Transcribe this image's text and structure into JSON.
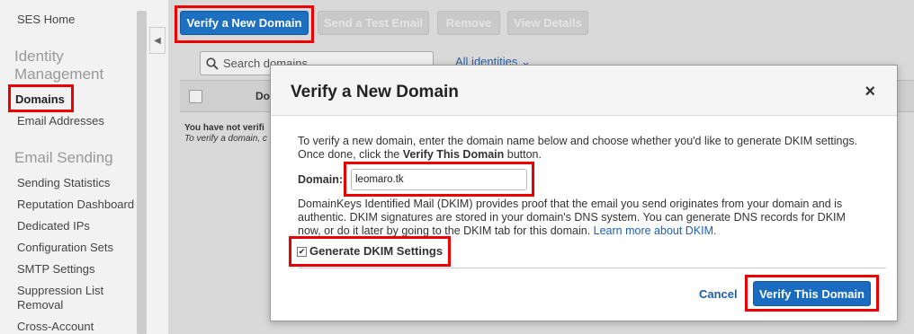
{
  "sidebar": {
    "ses_home": "SES Home",
    "identity_heading_1": "Identity",
    "identity_heading_2": "Management",
    "domains": "Domains",
    "email_addresses": "Email Addresses",
    "email_sending_heading": "Email Sending",
    "items": [
      "Sending Statistics",
      "Reputation Dashboard",
      "Dedicated IPs",
      "Configuration Sets",
      "SMTP Settings",
      "Suppression List",
      "Removal",
      "Cross-Account"
    ]
  },
  "toolbar": {
    "verify_domain": "Verify a New Domain",
    "send_test": "Send a Test Email",
    "remove": "Remove",
    "view_details": "View Details"
  },
  "search": {
    "placeholder": "Search domains"
  },
  "filter": {
    "label": "All identities"
  },
  "table": {
    "column": "Do",
    "empty_line_1": "You have not verifi",
    "empty_line_2": "To verify a domain, c"
  },
  "modal": {
    "title": "Verify a New Domain",
    "close": "×",
    "intro_1": "To verify a new domain, enter the domain name below and choose whether you'd like to generate DKIM settings.",
    "intro_2a": "Once done, click the ",
    "intro_2b": "Verify This Domain",
    "intro_2c": " button.",
    "domain_label": "Domain:",
    "domain_value": "leomaro.tk",
    "dkim_1": "DomainKeys Identified Mail (DKIM) provides proof that the email you send originates from your domain and is",
    "dkim_2": "authentic. DKIM signatures are stored in your domain's DNS system. You can generate DNS records for DKIM",
    "dkim_3": "now, or do it later by going to the DKIM tab for this domain. ",
    "learn_more": "Learn more about DKIM.",
    "generate_dkim": "Generate DKIM Settings",
    "cancel": "Cancel",
    "verify": "Verify This Domain"
  },
  "colors": {
    "highlight": "#e00000",
    "primary": "#1a6cc1"
  }
}
